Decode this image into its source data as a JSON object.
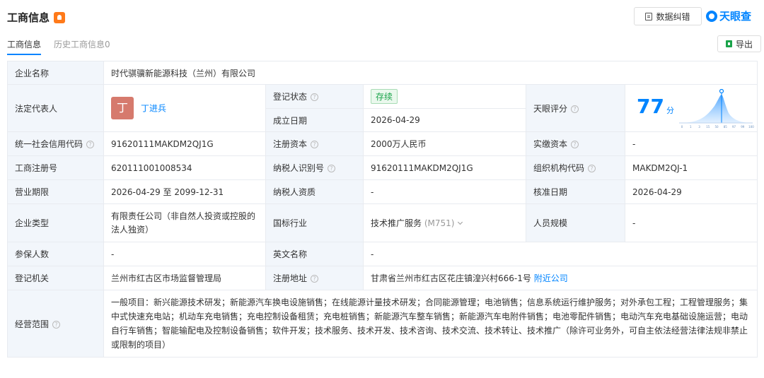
{
  "header": {
    "title": "工商信息",
    "fix_label": "数据纠错",
    "brand": "天眼查"
  },
  "tabs": {
    "active": "工商信息",
    "history": "历史工商信息",
    "history_count": "0",
    "export": "导出"
  },
  "company": {
    "name_label": "企业名称",
    "name": "时代骐骥新能源科技（兰州）有限公司",
    "rep_label": "法定代表人",
    "rep_avatar": "丁",
    "rep_name": "丁进兵",
    "status_label": "登记状态",
    "status": "存续",
    "founded_label": "成立日期",
    "founded": "2026-04-29",
    "rating_label": "天眼评分",
    "score": "77",
    "score_unit": "分",
    "score_ticks": [
      "0",
      "1",
      "3",
      "15",
      "50",
      "85",
      "97",
      "99",
      "100"
    ],
    "credit_label": "统一社会信用代码",
    "credit": "91620111MAKDM2QJ1G",
    "capital_label": "注册资本",
    "capital": "2000万人民币",
    "paid_label": "实缴资本",
    "paid": "-",
    "regno_label": "工商注册号",
    "regno": "620111001008534",
    "taxid_label": "纳税人识别号",
    "taxid": "91620111MAKDM2QJ1G",
    "orgcode_label": "组织机构代码",
    "orgcode": "MAKDM2QJ-1",
    "term_label": "营业期限",
    "term": "2026-04-29 至 2099-12-31",
    "taxtype_label": "纳税人资质",
    "taxtype": "-",
    "approve_label": "核准日期",
    "approve": "2026-04-29",
    "type_label": "企业类型",
    "type_line1": "有限责任公司（非自然人投资或控股的",
    "type_line2": "法人独资）",
    "industry_label": "国标行业",
    "industry": "技术推广服务",
    "industry_code": "(M751)",
    "staff_label": "人员规模",
    "staff": "-",
    "insured_label": "参保人数",
    "insured": "-",
    "en_label": "英文名称",
    "en": "-",
    "authority_label": "登记机关",
    "authority": "兰州市红古区市场监督管理局",
    "address_label": "注册地址",
    "address": "甘肃省兰州市红古区花庄镇湟兴村666-1号",
    "nearby": "附近公司",
    "scope_label": "经营范围",
    "scope": "一般项目：新兴能源技术研发；新能源汽车换电设施销售；在线能源计量技术研发；合同能源管理；电池销售；信息系统运行维护服务；对外承包工程；工程管理服务；集中式快速充电站；机动车充电销售；充电控制设备租赁；充电桩销售；新能源汽车整车销售；新能源汽车电附件销售；电池零配件销售；电动汽车充电基础设施运营；电动自行车销售；智能输配电及控制设备销售；软件开发；技术服务、技术开发、技术咨询、技术交流、技术转让、技术推广（除许可业务外，可自主依法经营法律法规非禁止或限制的项目）"
  },
  "colors": {
    "accent": "#0084ff",
    "label_bg": "#f2f6fb",
    "status_green": "#1aa34a",
    "avatar": "#d67a6d",
    "bell": "#ff7a1a"
  }
}
